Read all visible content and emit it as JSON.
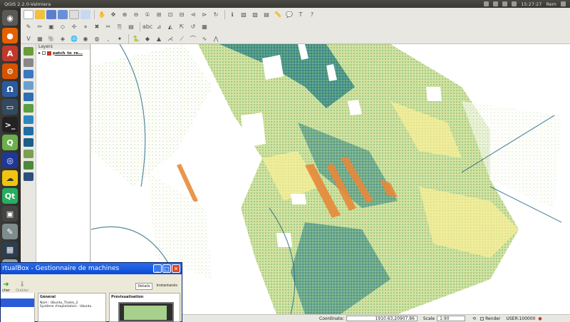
{
  "top_panel": {
    "title": "QGIS 2.2.0-Valmiera",
    "time": "15:27:27",
    "user": "Rem"
  },
  "layers_panel": {
    "header": "Layers",
    "layer_name": "patch_to_re..."
  },
  "statusbar": {
    "coordinate_label": "Coordinate:",
    "coordinate_value": "1910.63,20907.86",
    "scale_label": "Scale",
    "scale_value": "1:90",
    "render_label": "Render",
    "crs": "USER:100000"
  },
  "vbox": {
    "title": "rtualBox - Gestionnaire de machines",
    "toolbar": {
      "start": "cher",
      "discard": "Oublier",
      "details": "Détails",
      "snapshots": "Instantanés"
    },
    "general": {
      "heading": "Général",
      "name_label": "Nom :",
      "name_value": "Ubuntu_Thales_2",
      "os_label": "Système d'exploitation :",
      "os_value": "Ubuntu"
    },
    "preview_heading": "Prévisualisation"
  },
  "colors": {
    "accent": "#0a4ad8",
    "panel": "#3c3b37"
  }
}
